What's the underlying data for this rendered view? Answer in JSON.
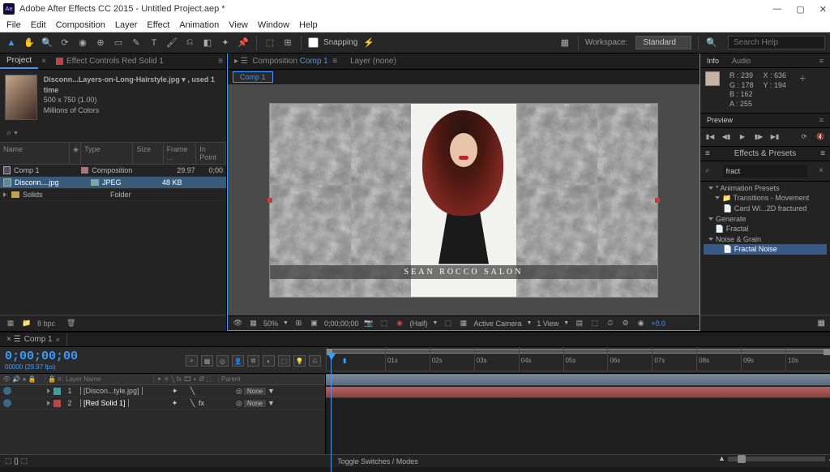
{
  "window": {
    "title": "Adobe After Effects CC 2015 - Untitled Project.aep *"
  },
  "menu": [
    "File",
    "Edit",
    "Composition",
    "Layer",
    "Effect",
    "Animation",
    "View",
    "Window",
    "Help"
  ],
  "toolbar": {
    "snapping_label": "Snapping",
    "workspace_label": "Workspace:",
    "workspace_value": "Standard",
    "search_placeholder": "Search Help"
  },
  "project": {
    "tabs": {
      "project": "Project",
      "effect_controls": "Effect Controls Red Solid 1"
    },
    "footage_name": "Disconn...Layers-on-Long-Hairstyle.jpg ▾ , used 1 time",
    "footage_dims": "500 x 750 (1.00)",
    "footage_colors": "Millions of Colors",
    "columns": {
      "name": "Name",
      "type": "Type",
      "size": "Size",
      "frame": "Frame ...",
      "inpoint": "In Point"
    },
    "items": [
      {
        "name": "Comp 1",
        "type": "Composition",
        "size": "",
        "fr": "29.97",
        "in": "0;00"
      },
      {
        "name": "Disconn....jpg",
        "type": "JPEG",
        "size": "48 KB",
        "fr": "",
        "in": ""
      },
      {
        "name": "Solids",
        "type": "Folder",
        "size": "",
        "fr": "",
        "in": ""
      }
    ],
    "bpc": "8 bpc"
  },
  "comp": {
    "panel_label": "Composition",
    "panel_comp": "Comp 1",
    "layer_tab": "Layer (none)",
    "render_tab": "Comp 1",
    "caption": "SEAN ROCCO SALON",
    "zoom": "50%",
    "time": "0;00;00;00",
    "res": "(Half)",
    "camera": "Active Camera",
    "views": "1 View",
    "exposure": "+0.0"
  },
  "info": {
    "tabs": {
      "info": "Info",
      "audio": "Audio"
    },
    "R": "R : 239",
    "G": "G : 178",
    "B": "B : 162",
    "A": "A : 255",
    "X": "X : 636",
    "Y": "Y : 194"
  },
  "preview": {
    "label": "Preview"
  },
  "effects": {
    "label": "Effects & Presets",
    "search": "fract",
    "tree": [
      {
        "t": "* Animation Presets",
        "lvl": 0
      },
      {
        "t": "Transitions - Movement",
        "lvl": 1
      },
      {
        "t": "Card Wi...2D fractured",
        "lvl": 2
      },
      {
        "t": "Generate",
        "lvl": 0
      },
      {
        "t": "Fractal",
        "lvl": 1
      },
      {
        "t": "Noise & Grain",
        "lvl": 0
      },
      {
        "t": "Fractal Noise",
        "lvl": 1,
        "sel": true
      }
    ]
  },
  "timeline": {
    "tab": "Comp 1",
    "timecode": "0;00;00;00",
    "fps": "00000 (29.97 fps)",
    "ruler": [
      "01s",
      "02s",
      "03s",
      "04s",
      "05s",
      "06s",
      "07s",
      "08s",
      "09s",
      "10s"
    ],
    "cols": {
      "layername": "Layer Name",
      "parent": "Parent"
    },
    "layers": [
      {
        "num": "1",
        "name": "[Discon...tyle.jpg]",
        "color": "teal",
        "parent": "None"
      },
      {
        "num": "2",
        "name": "[Red Solid 1]",
        "color": "red",
        "parent": "None"
      }
    ],
    "footer": "Toggle Switches / Modes"
  }
}
